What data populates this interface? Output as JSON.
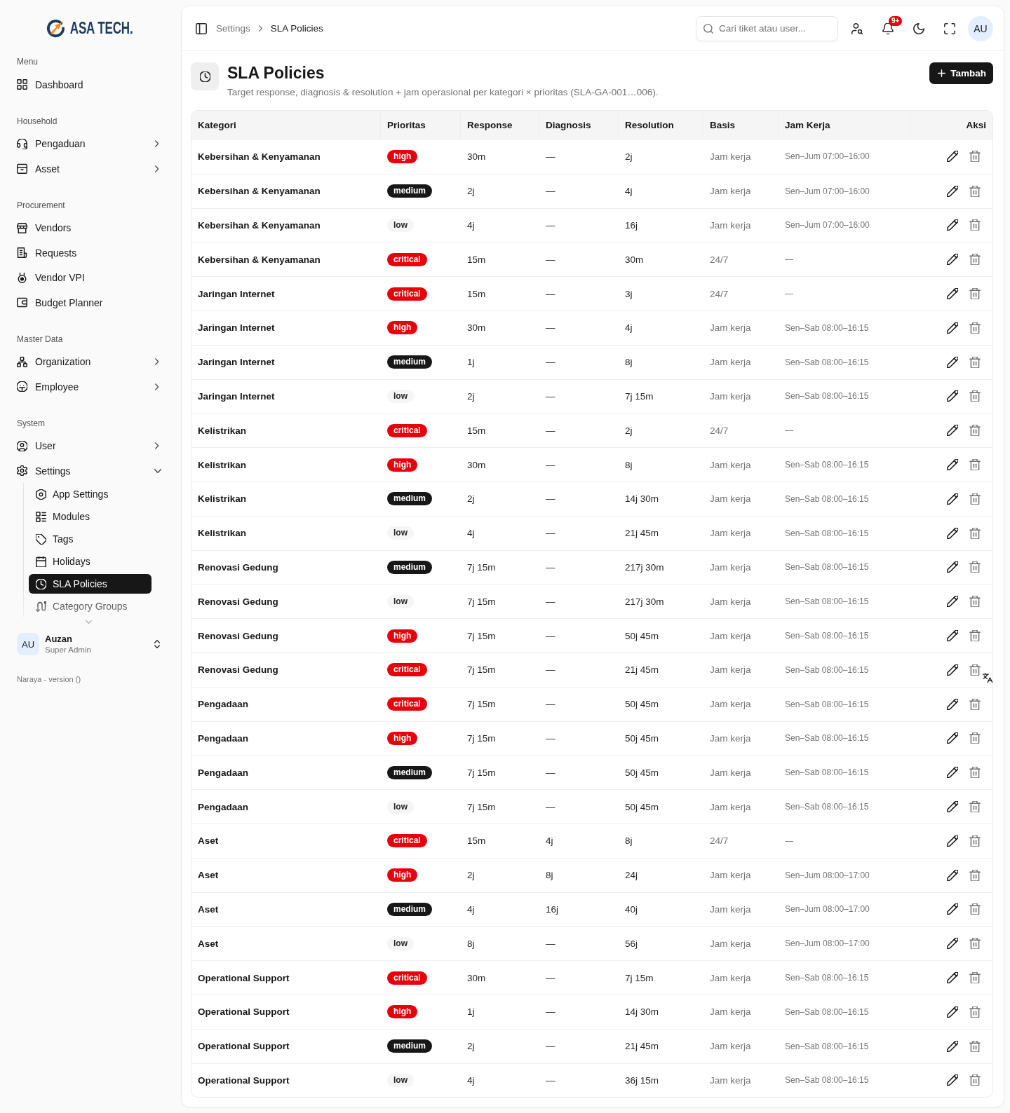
{
  "sidebar": {
    "brand": "ASA TECH.",
    "groups": [
      {
        "label": "Menu",
        "items": [
          {
            "label": "Dashboard",
            "kind": "link",
            "selected": false
          }
        ]
      },
      {
        "label": "Household",
        "items": [
          {
            "label": "Pengaduan",
            "kind": "menu",
            "expanded": false,
            "selected": false
          },
          {
            "label": "Asset",
            "kind": "menu",
            "expanded": false,
            "selected": false
          }
        ]
      },
      {
        "label": "Procurement",
        "items": [
          {
            "label": "Vendors",
            "kind": "link",
            "selected": false
          },
          {
            "label": "Requests",
            "kind": "link",
            "selected": false
          },
          {
            "label": "Vendor VPI",
            "kind": "link",
            "selected": false
          },
          {
            "label": "Budget Planner",
            "kind": "link",
            "selected": false
          }
        ]
      },
      {
        "label": "Master Data",
        "items": [
          {
            "label": "Organization",
            "kind": "menu",
            "expanded": false,
            "selected": false
          },
          {
            "label": "Employee",
            "kind": "menu",
            "expanded": false,
            "selected": false
          }
        ]
      },
      {
        "label": "System",
        "items": [
          {
            "label": "User",
            "kind": "menu",
            "expanded": false,
            "selected": false
          },
          {
            "label": "Settings",
            "kind": "menu",
            "expanded": true,
            "selected": false,
            "children": [
              {
                "label": "App Settings",
                "selected": false
              },
              {
                "label": "Modules",
                "selected": false
              },
              {
                "label": "Tags",
                "selected": false
              },
              {
                "label": "Holidays",
                "selected": false
              },
              {
                "label": "SLA Policies",
                "selected": true
              },
              {
                "label": "Category Groups",
                "selected": false
              }
            ]
          }
        ]
      }
    ],
    "user": {
      "initials": "AU",
      "name": "Auzan",
      "role": "Super Admin"
    },
    "version": "Naraya - version ()"
  },
  "header": {
    "breadcrumb": [
      "Settings",
      "SLA Policies"
    ],
    "search": {
      "placeholder": "Cari tiket atau user..."
    },
    "notification_badge": "9+",
    "avatar": "AU"
  },
  "page": {
    "title": "SLA Policies",
    "subtitle": "Target response, diagnosis & resolution + jam operasional per kategori × prioritas (SLA-GA-001…006).",
    "add_button": "Tambah"
  },
  "table": {
    "columns": [
      "Kategori",
      "Prioritas",
      "Response",
      "Diagnosis",
      "Resolution",
      "Basis",
      "Jam Kerja",
      "Aksi"
    ],
    "rows": [
      {
        "category": "Kebersihan & Kenyamanan",
        "priority": {
          "label": "high",
          "color": "#e7000b"
        },
        "response": "30m",
        "diagnosis": "—",
        "resolution": "2j",
        "basis": "Jam kerja",
        "hours": "Sen–Jum 07:00–16:00"
      },
      {
        "category": "Kebersihan & Kenyamanan",
        "priority": {
          "label": "medium",
          "color": "#171717"
        },
        "response": "2j",
        "diagnosis": "—",
        "resolution": "4j",
        "basis": "Jam kerja",
        "hours": "Sen–Jum 07:00–16:00"
      },
      {
        "category": "Kebersihan & Kenyamanan",
        "priority": {
          "label": "low",
          "color": "#f5f5f5"
        },
        "response": "4j",
        "diagnosis": "—",
        "resolution": "16j",
        "basis": "Jam kerja",
        "hours": "Sen–Jum 07:00–16:00"
      },
      {
        "category": "Kebersihan & Kenyamanan",
        "priority": {
          "label": "critical",
          "color": "#e7000b"
        },
        "response": "15m",
        "diagnosis": "—",
        "resolution": "30m",
        "basis": "24/7",
        "hours": "—"
      },
      {
        "category": "Jaringan Internet",
        "priority": {
          "label": "critical",
          "color": "#e7000b"
        },
        "response": "15m",
        "diagnosis": "—",
        "resolution": "3j",
        "basis": "24/7",
        "hours": "—"
      },
      {
        "category": "Jaringan Internet",
        "priority": {
          "label": "high",
          "color": "#e7000b"
        },
        "response": "30m",
        "diagnosis": "—",
        "resolution": "4j",
        "basis": "Jam kerja",
        "hours": "Sen–Sab 08:00–16:15"
      },
      {
        "category": "Jaringan Internet",
        "priority": {
          "label": "medium",
          "color": "#171717"
        },
        "response": "1j",
        "diagnosis": "—",
        "resolution": "8j",
        "basis": "Jam kerja",
        "hours": "Sen–Sab 08:00–16:15"
      },
      {
        "category": "Jaringan Internet",
        "priority": {
          "label": "low",
          "color": "#f5f5f5"
        },
        "response": "2j",
        "diagnosis": "—",
        "resolution": "7j 15m",
        "basis": "Jam kerja",
        "hours": "Sen–Sab 08:00–16:15"
      },
      {
        "category": "Kelistrikan",
        "priority": {
          "label": "critical",
          "color": "#e7000b"
        },
        "response": "15m",
        "diagnosis": "—",
        "resolution": "2j",
        "basis": "24/7",
        "hours": "—"
      },
      {
        "category": "Kelistrikan",
        "priority": {
          "label": "high",
          "color": "#e7000b"
        },
        "response": "30m",
        "diagnosis": "—",
        "resolution": "8j",
        "basis": "Jam kerja",
        "hours": "Sen–Sab 08:00–16:15"
      },
      {
        "category": "Kelistrikan",
        "priority": {
          "label": "medium",
          "color": "#171717"
        },
        "response": "2j",
        "diagnosis": "—",
        "resolution": "14j 30m",
        "basis": "Jam kerja",
        "hours": "Sen–Sab 08:00–16:15"
      },
      {
        "category": "Kelistrikan",
        "priority": {
          "label": "low",
          "color": "#f5f5f5"
        },
        "response": "4j",
        "diagnosis": "—",
        "resolution": "21j 45m",
        "basis": "Jam kerja",
        "hours": "Sen–Sab 08:00–16:15"
      },
      {
        "category": "Renovasi Gedung",
        "priority": {
          "label": "medium",
          "color": "#171717"
        },
        "response": "7j 15m",
        "diagnosis": "—",
        "resolution": "217j 30m",
        "basis": "Jam kerja",
        "hours": "Sen–Sab 08:00–16:15"
      },
      {
        "category": "Renovasi Gedung",
        "priority": {
          "label": "low",
          "color": "#f5f5f5"
        },
        "response": "7j 15m",
        "diagnosis": "—",
        "resolution": "217j 30m",
        "basis": "Jam kerja",
        "hours": "Sen–Sab 08:00–16:15"
      },
      {
        "category": "Renovasi Gedung",
        "priority": {
          "label": "high",
          "color": "#e7000b"
        },
        "response": "7j 15m",
        "diagnosis": "—",
        "resolution": "50j 45m",
        "basis": "Jam kerja",
        "hours": "Sen–Sab 08:00–16:15"
      },
      {
        "category": "Renovasi Gedung",
        "priority": {
          "label": "critical",
          "color": "#e7000b"
        },
        "response": "7j 15m",
        "diagnosis": "—",
        "resolution": "21j 45m",
        "basis": "Jam kerja",
        "hours": "Sen–Sab 08:00–16:15"
      },
      {
        "category": "Pengadaan",
        "priority": {
          "label": "critical",
          "color": "#e7000b"
        },
        "response": "7j 15m",
        "diagnosis": "—",
        "resolution": "50j 45m",
        "basis": "Jam kerja",
        "hours": "Sen–Sab 08:00–16:15"
      },
      {
        "category": "Pengadaan",
        "priority": {
          "label": "high",
          "color": "#e7000b"
        },
        "response": "7j 15m",
        "diagnosis": "—",
        "resolution": "50j 45m",
        "basis": "Jam kerja",
        "hours": "Sen–Sab 08:00–16:15"
      },
      {
        "category": "Pengadaan",
        "priority": {
          "label": "medium",
          "color": "#171717"
        },
        "response": "7j 15m",
        "diagnosis": "—",
        "resolution": "50j 45m",
        "basis": "Jam kerja",
        "hours": "Sen–Sab 08:00–16:15"
      },
      {
        "category": "Pengadaan",
        "priority": {
          "label": "low",
          "color": "#f5f5f5"
        },
        "response": "7j 15m",
        "diagnosis": "—",
        "resolution": "50j 45m",
        "basis": "Jam kerja",
        "hours": "Sen–Sab 08:00–16:15"
      },
      {
        "category": "Aset",
        "priority": {
          "label": "critical",
          "color": "#e7000b"
        },
        "response": "15m",
        "diagnosis": "4j",
        "resolution": "8j",
        "basis": "24/7",
        "hours": "—"
      },
      {
        "category": "Aset",
        "priority": {
          "label": "high",
          "color": "#e7000b"
        },
        "response": "2j",
        "diagnosis": "8j",
        "resolution": "24j",
        "basis": "Jam kerja",
        "hours": "Sen–Jum 08:00–17:00"
      },
      {
        "category": "Aset",
        "priority": {
          "label": "medium",
          "color": "#171717"
        },
        "response": "4j",
        "diagnosis": "16j",
        "resolution": "40j",
        "basis": "Jam kerja",
        "hours": "Sen–Jum 08:00–17:00"
      },
      {
        "category": "Aset",
        "priority": {
          "label": "low",
          "color": "#f5f5f5"
        },
        "response": "8j",
        "diagnosis": "—",
        "resolution": "56j",
        "basis": "Jam kerja",
        "hours": "Sen–Jum 08:00–17:00"
      },
      {
        "category": "Operational Support",
        "priority": {
          "label": "critical",
          "color": "#e7000b"
        },
        "response": "30m",
        "diagnosis": "—",
        "resolution": "7j 15m",
        "basis": "Jam kerja",
        "hours": "Sen–Sab 08:00–16:15"
      },
      {
        "category": "Operational Support",
        "priority": {
          "label": "high",
          "color": "#e7000b"
        },
        "response": "1j",
        "diagnosis": "—",
        "resolution": "14j 30m",
        "basis": "Jam kerja",
        "hours": "Sen–Sab 08:00–16:15"
      },
      {
        "category": "Operational Support",
        "priority": {
          "label": "medium",
          "color": "#171717"
        },
        "response": "2j",
        "diagnosis": "—",
        "resolution": "21j 45m",
        "basis": "Jam kerja",
        "hours": "Sen–Sab 08:00–16:15"
      },
      {
        "category": "Operational Support",
        "priority": {
          "label": "low",
          "color": "#f5f5f5"
        },
        "response": "4j",
        "diagnosis": "—",
        "resolution": "36j 15m",
        "basis": "Jam kerja",
        "hours": "Sen–Sab 08:00–16:15"
      }
    ]
  }
}
